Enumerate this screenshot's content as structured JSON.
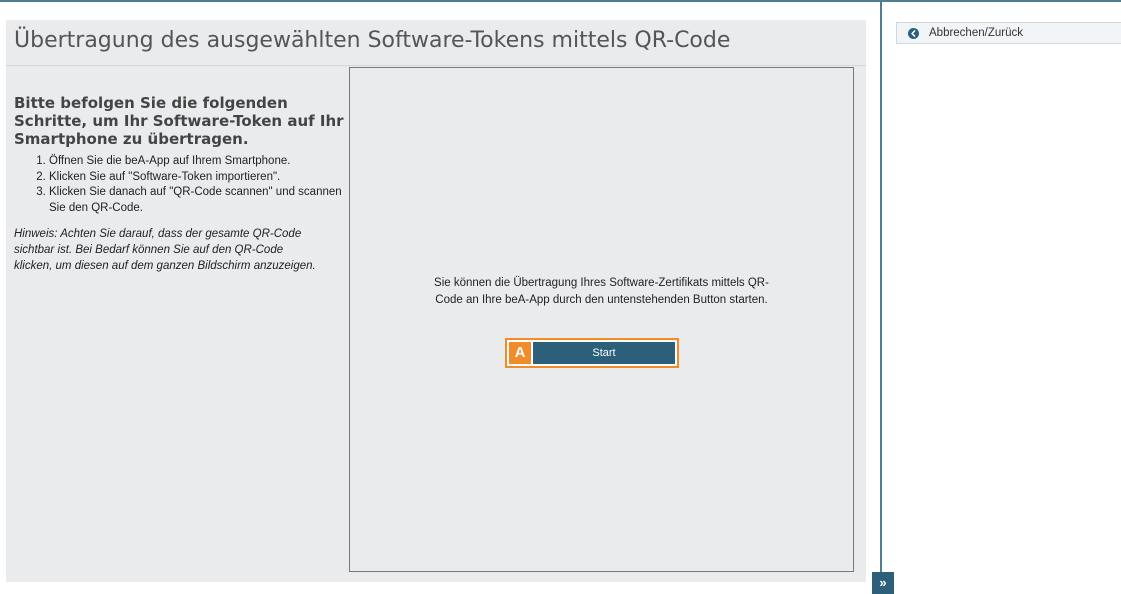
{
  "main": {
    "title": "Übertragung des ausgewählten Software-Tokens mittels QR-Code",
    "instructions": {
      "heading": "Bitte befolgen Sie die folgenden Schritte, um Ihr Software-Token auf Ihr Smartphone zu übertragen.",
      "steps": [
        "Öffnen Sie die beA-App auf Ihrem Smartphone.",
        "Klicken Sie auf \"Software-Token importieren\".",
        "Klicken Sie danach auf \"QR-Code scannen\" und scannen Sie den QR-Code."
      ],
      "hint": "Hinweis: Achten Sie darauf, dass der gesamte QR-Code sichtbar ist. Bei Bedarf können Sie auf den QR-Code klicken, um diesen auf dem ganzen Bildschirm anzuzeigen."
    },
    "qr_panel": {
      "message": "Sie können die Übertragung Ihres Software-Zertifikats mittels QR-Code an Ihre beA-App durch den untenstehenden Button starten.",
      "start_label": "Start",
      "marker_label": "A"
    }
  },
  "sidebar": {
    "cancel_label": "Abbrechen/Zurück",
    "cancel_icon": "arrow-left-circle-icon",
    "expand_label": "»",
    "expand_icon": "double-chevron-right-icon"
  },
  "colors": {
    "accent": "#2b5f7a",
    "highlight": "#f28c28",
    "panel_background": "#e9ebed"
  }
}
